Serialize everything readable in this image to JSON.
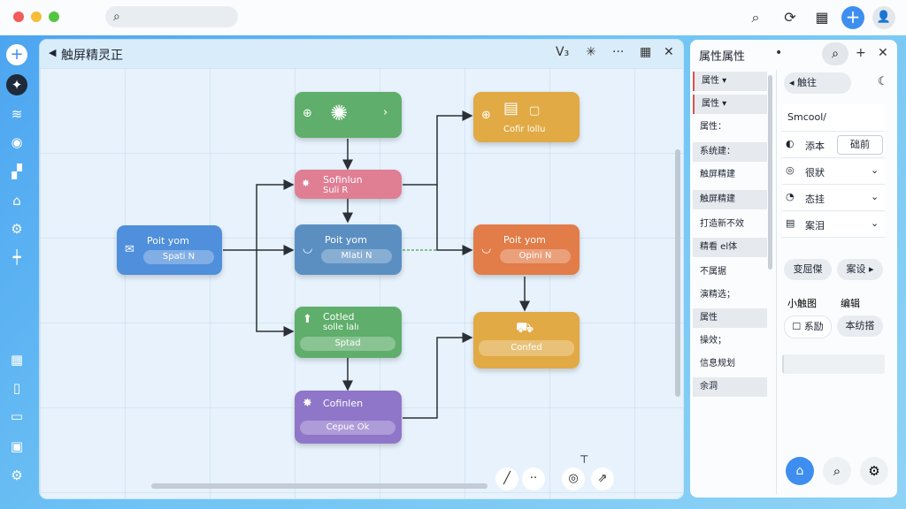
{
  "colors": {
    "accent": "#3e8ef0",
    "green": "#5fae6b",
    "pink": "#e07e94",
    "blue": "#4f8fdc",
    "steel": "#5b8fc2",
    "orange": "#e27c48",
    "mustard": "#e1aa44",
    "purple": "#8f76c9"
  },
  "topbar": {
    "icons": [
      "search-icon",
      "sync-icon",
      "grid-icon",
      "plus-icon",
      "user-icon"
    ]
  },
  "canvas": {
    "title": "触屏精灵正",
    "tools": {
      "version": "V₃",
      "more": "···"
    }
  },
  "nodes": {
    "start": {
      "icon": "plus-icon",
      "glyph": "✺"
    },
    "pink": {
      "title": "Sofinlun",
      "sub": "Suli R"
    },
    "blue_left": {
      "title": "Poit yom",
      "pill": "Spati N"
    },
    "blue_mid": {
      "title": "Poit yom",
      "pill": "Mlati N"
    },
    "green": {
      "title": "Cotled",
      "sub": "solle lalı",
      "pill": "Sptad"
    },
    "purple": {
      "title": "Cofinlen",
      "pill": "Cepue Ok"
    },
    "mustard_top": {
      "title": "Cofir lollu"
    },
    "orange": {
      "title": "Poit yom",
      "pill": "Opini N"
    },
    "mustard_bottom": {
      "pill": "Confed"
    }
  },
  "right_panel": {
    "title": "属性属性",
    "list": [
      "属性 ▾",
      "属性 ▾",
      "属性：",
      "系统建：",
      "触屏精建",
      "触屏精建",
      "打造新不效",
      "精看 el体",
      "不属据",
      "演精选；",
      "属性",
      "操效；",
      "信息规划",
      "余洞"
    ],
    "back_label": "◂ 触往",
    "search_value": "Smcool/",
    "rows": [
      {
        "icon": "◐",
        "label": "添本",
        "value": "础前"
      },
      {
        "icon": "◎",
        "label": "很狀"
      },
      {
        "icon": "◔",
        "label": "态挂"
      },
      {
        "icon": "▤",
        "label": "案泪"
      }
    ],
    "chips": [
      "变屈傑",
      "案设 ▸"
    ],
    "tabs": [
      "小触图",
      "编辑"
    ],
    "check_label": "系励",
    "chip3": "本纺搭"
  }
}
